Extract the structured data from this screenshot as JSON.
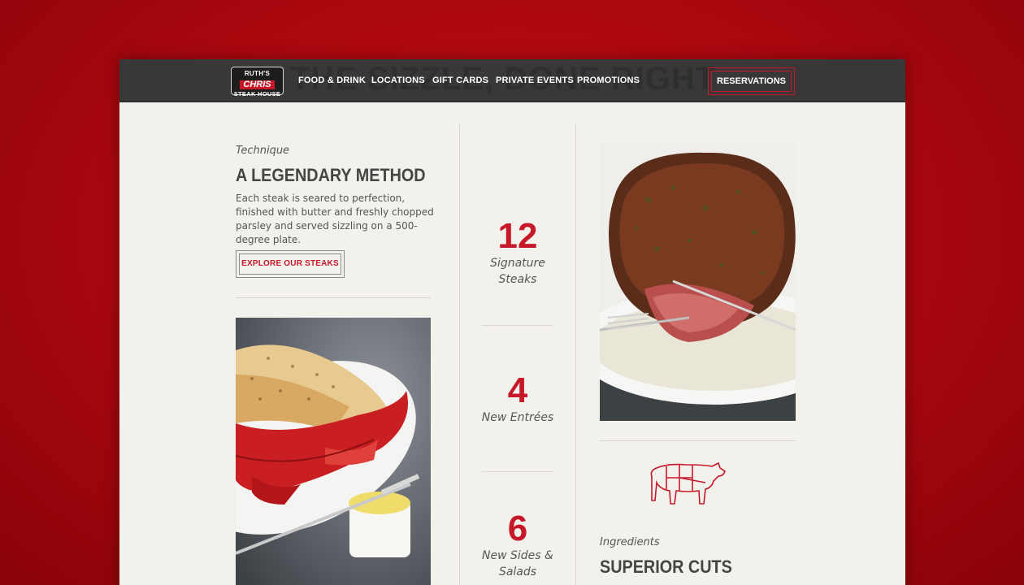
{
  "brand": {
    "logo_line1": "RUTH'S",
    "logo_line2": "CHRIS",
    "logo_line3": "STEAK HOUSE",
    "accent": "#c7182a"
  },
  "header_backdrop_text": "THE SIZZLE, DONE RIGHT",
  "nav": {
    "items": [
      {
        "label": "FOOD & DRINK"
      },
      {
        "label": "LOCATIONS"
      },
      {
        "label": "GIFT CARDS"
      },
      {
        "label": "PRIVATE EVENTS"
      },
      {
        "label": "PROMOTIONS"
      }
    ],
    "cta": "RESERVATIONS"
  },
  "technique": {
    "eyebrow": "Technique",
    "heading": "A LEGENDARY METHOD",
    "body": "Each steak is seared to perfection, finished with butter and freshly chopped parsley and served sizzling on a 500-degree plate.",
    "button": "EXPLORE OUR STEAKS"
  },
  "stats": [
    {
      "number": "12",
      "label_line1": "Signature",
      "label_line2": "Steaks"
    },
    {
      "number": "4",
      "label_line1": "New Entrées",
      "label_line2": ""
    },
    {
      "number": "6",
      "label_line1": "New Sides &",
      "label_line2": "Salads"
    }
  ],
  "ingredients": {
    "eyebrow": "Ingredients",
    "heading": "SUPERIOR CUTS"
  },
  "images": {
    "lobster": "lobster-tail-photo",
    "steak": "steak-photo",
    "cow": "cow-cuts-icon"
  }
}
